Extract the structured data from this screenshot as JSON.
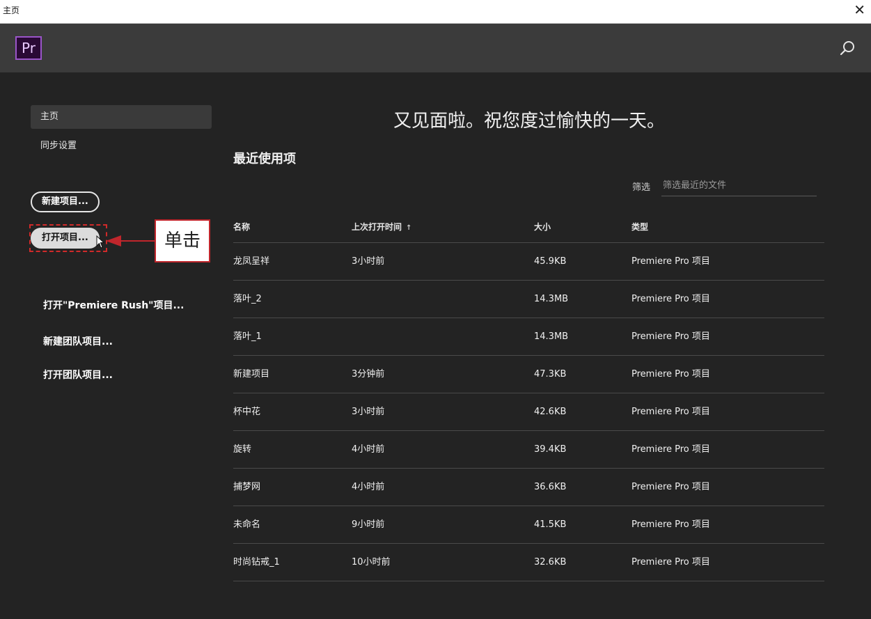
{
  "window": {
    "title": "主页",
    "close_glyph": "✕"
  },
  "header": {
    "logo_text": "Pr",
    "search_icon": "search-icon"
  },
  "sidebar": {
    "items": [
      {
        "label": "主页"
      },
      {
        "label": "同步设置"
      }
    ],
    "new_project": "新建项目...",
    "open_project": "打开项目...",
    "actions": [
      {
        "label": "打开\"Premiere Rush\"项目..."
      },
      {
        "label": "新建团队项目..."
      },
      {
        "label": "打开团队项目..."
      }
    ]
  },
  "annotation": {
    "callout": "单击"
  },
  "main": {
    "greeting": "又见面啦。祝您度过愉快的一天。",
    "recent_title": "最近使用项",
    "filter_label": "筛选",
    "filter_placeholder": "筛选最近的文件",
    "columns": {
      "name": "名称",
      "time": "上次打开时间",
      "size": "大小",
      "type": "类型",
      "sort_glyph": "↑"
    },
    "rows": [
      {
        "name": "龙凤呈祥",
        "time": "3小时前",
        "size": "45.9KB",
        "type": "Premiere Pro 项目"
      },
      {
        "name": "落叶_2",
        "time": "",
        "size": "14.3MB",
        "type": "Premiere Pro 项目"
      },
      {
        "name": "落叶_1",
        "time": "",
        "size": "14.3MB",
        "type": "Premiere Pro 项目"
      },
      {
        "name": "新建项目",
        "time": "3分钟前",
        "size": "47.3KB",
        "type": "Premiere Pro 项目"
      },
      {
        "name": "杯中花",
        "time": "3小时前",
        "size": "42.6KB",
        "type": "Premiere Pro 项目"
      },
      {
        "name": "旋转",
        "time": "4小时前",
        "size": "39.4KB",
        "type": "Premiere Pro 项目"
      },
      {
        "name": "捕梦网",
        "time": "4小时前",
        "size": "36.6KB",
        "type": "Premiere Pro 项目"
      },
      {
        "name": "未命名",
        "time": "9小时前",
        "size": "41.5KB",
        "type": "Premiere Pro 项目"
      },
      {
        "name": "时尚钻戒_1",
        "time": "10小时前",
        "size": "32.6KB",
        "type": "Premiere Pro 项目"
      }
    ]
  },
  "colors": {
    "accent": "#9a55c9",
    "highlight": "#c0262c"
  }
}
